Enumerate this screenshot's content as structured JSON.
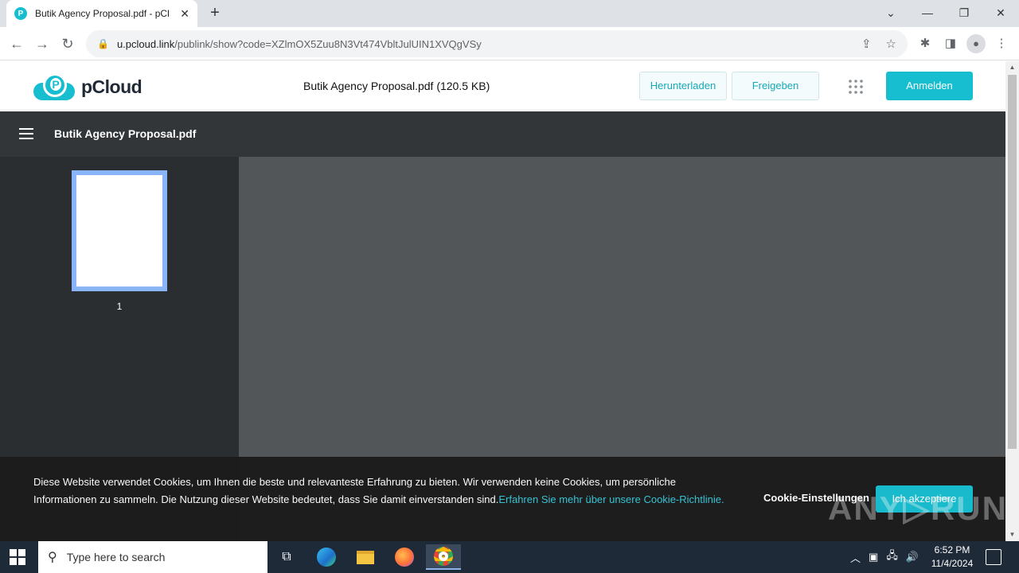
{
  "browser": {
    "tab_title": "Butik Agency Proposal.pdf - pCl",
    "tab_close": "✕",
    "new_tab": "+",
    "url_host": "u.pcloud.link",
    "url_rest": "/publink/show?code=XZlmOX5Zuu8N3Vt474VbltJulUIN1XVQgVSy"
  },
  "header": {
    "brand": "pCloud",
    "file_title": "Butik Agency Proposal.pdf (120.5 KB)",
    "download_label": "Herunterladen",
    "share_label": "Freigeben",
    "signin_label": "Anmelden"
  },
  "viewer": {
    "title": "Butik Agency Proposal.pdf",
    "page_number": "1"
  },
  "cookie": {
    "text": "Diese Website verwendet Cookies, um Ihnen die beste und relevanteste Erfahrung zu bieten. Wir verwenden keine Cookies, um persönliche Informationen zu sammeln. Die Nutzung dieser Website bedeutet, dass Sie damit einverstanden sind.",
    "link": "Erfahren Sie mehr über unsere Cookie-Richtlinie.",
    "settings_label": "Cookie-Einstellungen",
    "accept_label": "Ich akzeptiere"
  },
  "watermark": "ANY▷RUN",
  "taskbar": {
    "search_placeholder": "Type here to search",
    "time": "6:52 PM",
    "date": "11/4/2024"
  },
  "colors": {
    "accent": "#17bed0",
    "viewer_bar": "#323639",
    "sidebar": "#2b2e31",
    "main": "#525659"
  }
}
